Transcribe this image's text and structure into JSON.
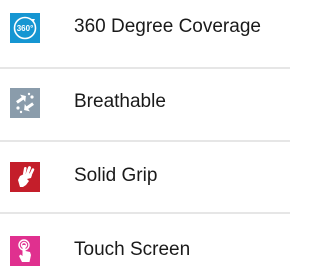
{
  "features": [
    {
      "label": "360 Degree Coverage",
      "icon": "rotation-360-icon",
      "icon_text": "360°",
      "color": "#1696d2"
    },
    {
      "label": "Breathable",
      "icon": "airflow-arrows-icon",
      "color": "#8a9cab"
    },
    {
      "label": "Solid Grip",
      "icon": "gripping-hand-icon",
      "color": "#c41e2a"
    },
    {
      "label": "Touch Screen",
      "icon": "finger-tap-icon",
      "color": "#e0308f"
    }
  ]
}
